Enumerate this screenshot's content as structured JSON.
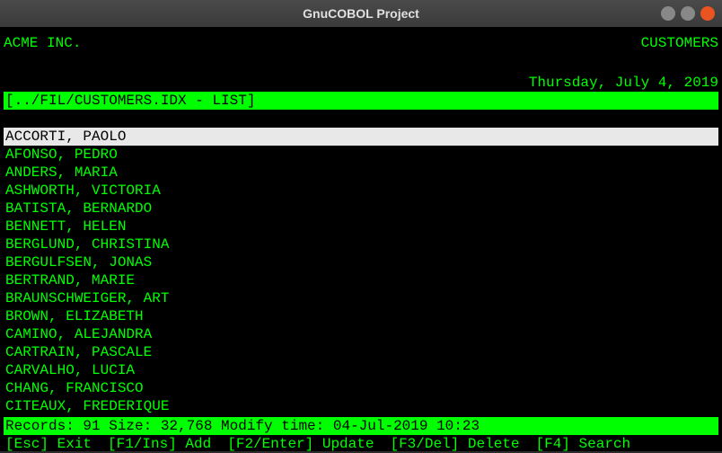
{
  "window": {
    "title": "GnuCOBOL Project"
  },
  "header": {
    "company": "ACME INC.",
    "screen": "CUSTOMERS",
    "date": "Thursday, July 4, 2019"
  },
  "context": {
    "label": "[../FIL/CUSTOMERS.IDX - LIST]"
  },
  "list": {
    "selected_index": 0,
    "items": [
      "ACCORTI, PAOLO",
      "AFONSO, PEDRO",
      "ANDERS, MARIA",
      "ASHWORTH, VICTORIA",
      "BATISTA, BERNARDO",
      "BENNETT, HELEN",
      "BERGLUND, CHRISTINA",
      "BERGULFSEN, JONAS",
      "BERTRAND, MARIE",
      "BRAUNSCHWEIGER, ART",
      "BROWN, ELIZABETH",
      "CAMINO, ALEJANDRA",
      "CARTRAIN, PASCALE",
      "CARVALHO, LUCIA",
      "CHANG, FRANCISCO",
      "CITEAUX, FREDERIQUE"
    ]
  },
  "status": {
    "text": "Records: 91 Size: 32,768 Modify time: 04-Jul-2019 10:23"
  },
  "fnkeys": {
    "esc": "[Esc] Exit",
    "f1": "[F1/Ins] Add",
    "f2": "[F2/Enter] Update",
    "f3": "[F3/Del] Delete",
    "f4": "[F4] Search"
  }
}
